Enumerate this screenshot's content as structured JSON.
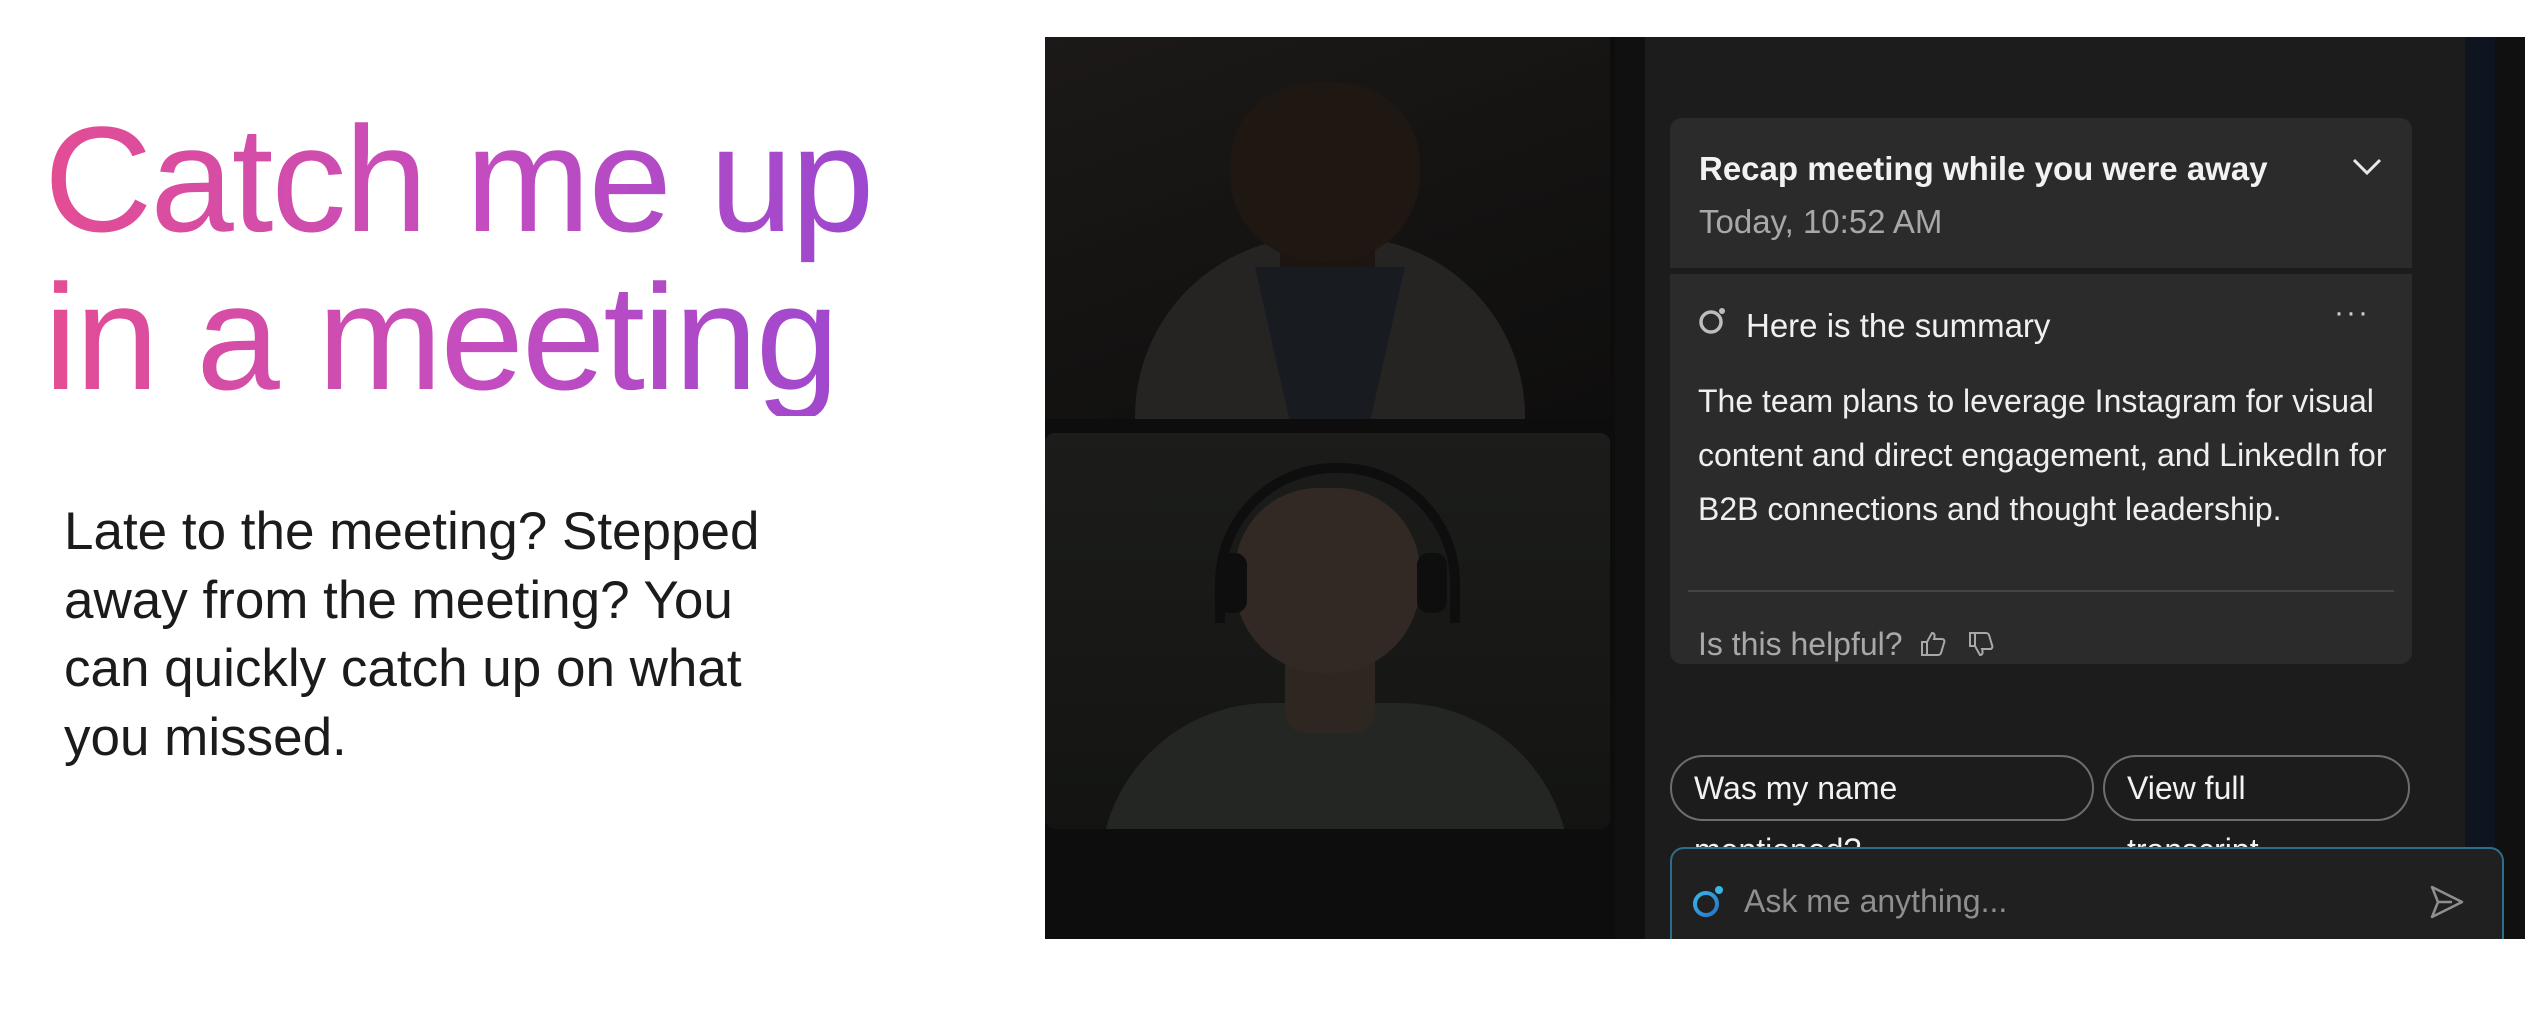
{
  "slide": {
    "headline": "Catch me up in a meeting",
    "body": "Late to the meeting? Stepped away from the meeting? You can quickly catch up on what you missed."
  },
  "video": {
    "tiles": [
      "participant-1",
      "participant-2"
    ]
  },
  "recap": {
    "title": "Recap meeting while you were away",
    "time": "Today, 10:52 AM"
  },
  "summary": {
    "label": "Here is the summary",
    "more": "···",
    "text": "The team plans to leverage Instagram for visual content and direct engagement, and LinkedIn for B2B connections and thought leadership.",
    "feedback_prompt": "Is this helpful?"
  },
  "suggestions": [
    {
      "label": "Was my name mentioned?"
    },
    {
      "label": "View full transcript"
    }
  ],
  "ask": {
    "placeholder": "Ask me anything..."
  },
  "colors": {
    "headline_gradient_start": "#e34d93",
    "headline_gradient_end": "#8f46d4",
    "panel_bg": "#1c1c1c",
    "card_bg": "#2b2b2b",
    "input_accent": "#2d6f8a"
  },
  "icons": [
    "chevron-down-icon",
    "ai-assistant-icon",
    "more-icon",
    "thumbs-up-icon",
    "thumbs-down-icon",
    "send-icon"
  ]
}
